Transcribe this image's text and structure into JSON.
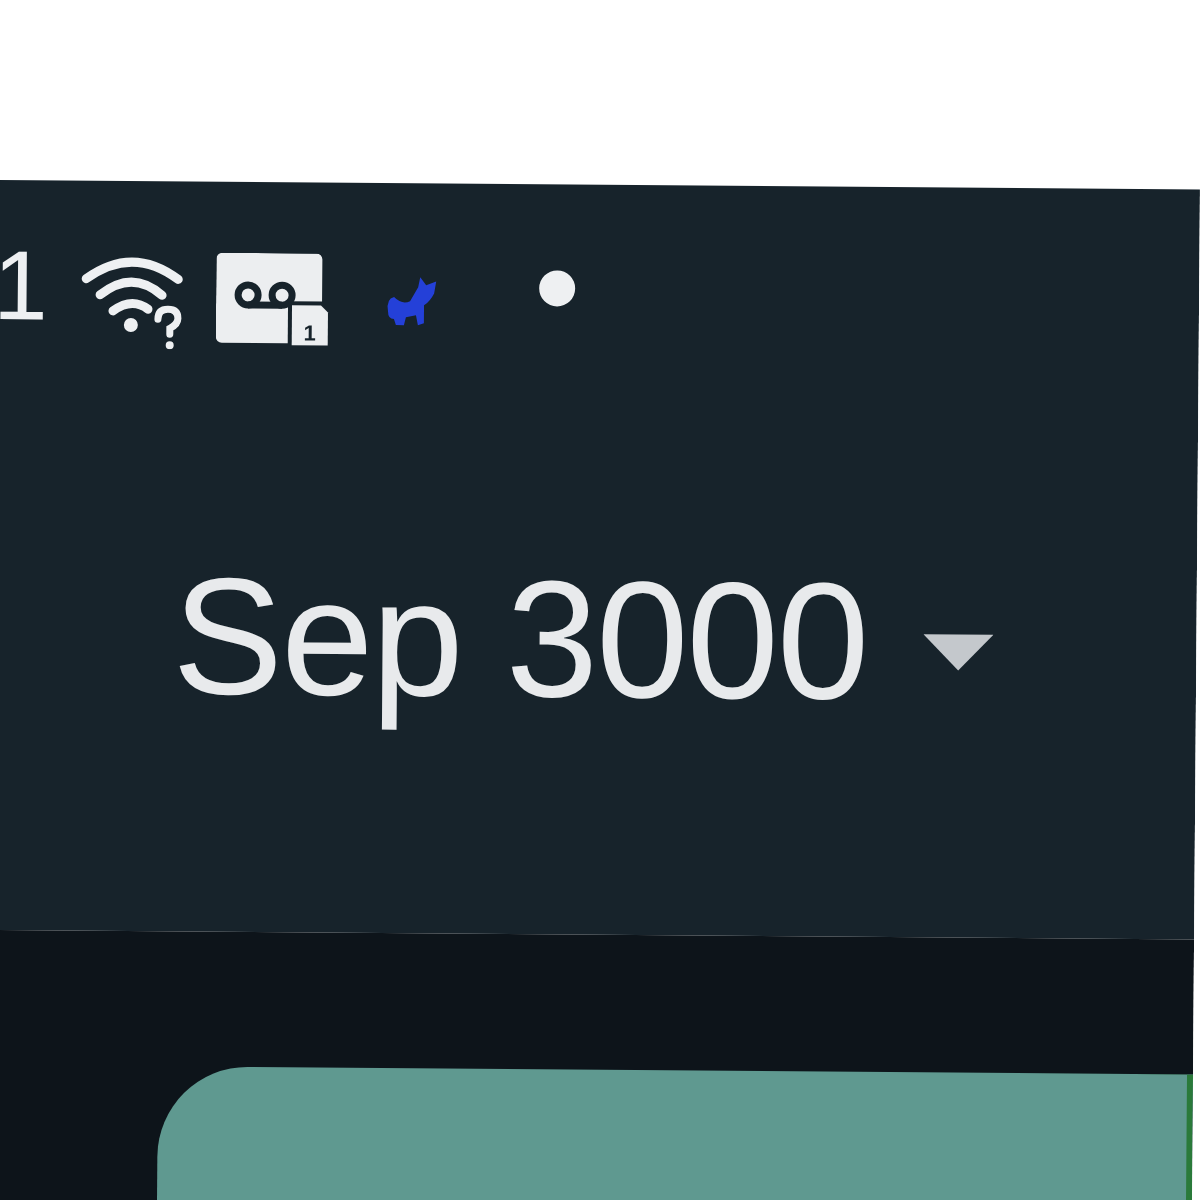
{
  "status_bar": {
    "time": "1",
    "icons": [
      {
        "kind": "wifi"
      },
      {
        "kind": "voicemail",
        "badge": "1"
      },
      {
        "kind": "cat"
      },
      {
        "kind": "dot"
      }
    ]
  },
  "header": {
    "month_picker": {
      "label": "Sep 3000",
      "expanded": false
    }
  }
}
